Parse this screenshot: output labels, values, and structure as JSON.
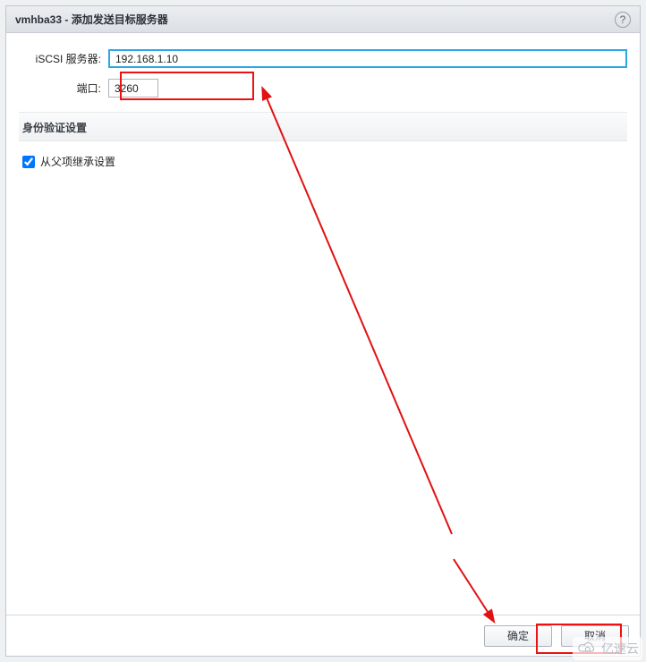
{
  "dialog": {
    "title": "vmhba33 - 添加发送目标服务器"
  },
  "form": {
    "server_label": "iSCSI 服务器:",
    "server_value": "192.168.1.10",
    "port_label": "端口:",
    "port_value": "3260"
  },
  "auth": {
    "section_label": "身份验证设置",
    "inherit_label": "从父项继承设置",
    "inherit_checked": true
  },
  "buttons": {
    "ok": "确定",
    "cancel": "取消"
  },
  "watermark": {
    "text": "亿速云"
  },
  "annotation": {
    "highlight_color": "#e11111"
  }
}
